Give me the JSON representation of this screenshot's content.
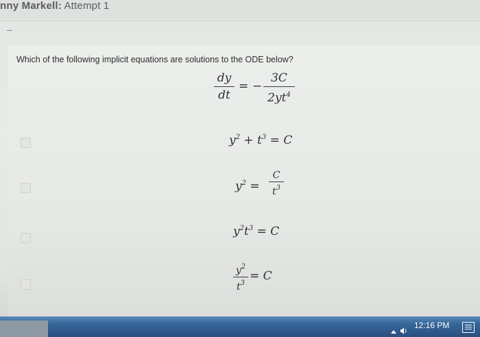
{
  "header": {
    "name": "nny Markell:",
    "attempt": " Attempt 1"
  },
  "question": {
    "text": "Which of the following implicit equations are solutions to the ODE below?",
    "ode": {
      "lhs_num": "dy",
      "lhs_den": "dt",
      "equals": "=",
      "minus": "−",
      "rhs_num": "3C",
      "rhs_den_base": "2yt",
      "rhs_den_exp": "4"
    }
  },
  "options": [
    {
      "y": "y",
      "y_exp": "2",
      "plus": " + ",
      "t": "t",
      "t_exp": "3",
      "rest": " = C"
    },
    {
      "lhs": "y",
      "lhs_exp": "2",
      "eq": " = ",
      "num": "C",
      "den": "t",
      "den_exp": "3"
    },
    {
      "y": "y",
      "y_exp": "2",
      "t": "t",
      "t_exp": "3",
      "rest": " = C"
    },
    {
      "num": "y",
      "num_exp": "2",
      "den": "t",
      "den_exp": "3",
      "rest": " = C"
    }
  ],
  "taskbar": {
    "clock": "12:16 PM"
  },
  "icons": {
    "tray_chevron": "chevron-up-icon",
    "speaker": "speaker-icon",
    "notifications": "notification-icon"
  },
  "colors": {
    "taskbar": "#2f5f93",
    "background": "#e7e9e6"
  }
}
